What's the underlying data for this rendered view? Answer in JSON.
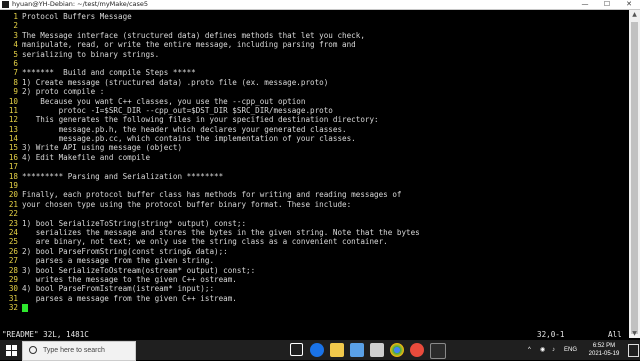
{
  "window": {
    "title": "hyuan@YH-Debian: ~/test/myMake/case5",
    "minimize": "—",
    "maximize": "☐",
    "close": "✕"
  },
  "editor": {
    "lines": [
      {
        "n": "1",
        "t": "Protocol Buffers Message"
      },
      {
        "n": "2",
        "t": ""
      },
      {
        "n": "3",
        "t": "The Message interface (structured data) defines methods that let you check,"
      },
      {
        "n": "4",
        "t": "manipulate, read, or write the entire message, including parsing from and"
      },
      {
        "n": "5",
        "t": "serializing to binary strings."
      },
      {
        "n": "6",
        "t": ""
      },
      {
        "n": "7",
        "t": "*******  Build and compile Steps *****"
      },
      {
        "n": "8",
        "t": "1) Create message (structured data) .proto file (ex. message.proto)"
      },
      {
        "n": "9",
        "t": "2) proto compile :"
      },
      {
        "n": "10",
        "t": "    Because you want C++ classes, you use the --cpp_out option"
      },
      {
        "n": "11",
        "t": "        protoc -I=$SRC_DIR --cpp_out=$DST_DIR $SRC_DIR/message.proto"
      },
      {
        "n": "12",
        "t": "   This generates the following files in your specified destination directory:"
      },
      {
        "n": "13",
        "t": "        message.pb.h, the header which declares your generated classes."
      },
      {
        "n": "14",
        "t": "        message.pb.cc, which contains the implementation of your classes."
      },
      {
        "n": "15",
        "t": "3) Write API using message (object)"
      },
      {
        "n": "16",
        "t": "4) Edit Makefile and compile"
      },
      {
        "n": "17",
        "t": ""
      },
      {
        "n": "18",
        "t": "********* Parsing and Serialization ********"
      },
      {
        "n": "19",
        "t": ""
      },
      {
        "n": "20",
        "t": "Finally, each protocol buffer class has methods for writing and reading messages of"
      },
      {
        "n": "21",
        "t": "your chosen type using the protocol buffer binary format. These include:"
      },
      {
        "n": "22",
        "t": ""
      },
      {
        "n": "23",
        "t": "1) bool SerializeToString(string* output) const;:"
      },
      {
        "n": "24",
        "t": "   serializes the message and stores the bytes in the given string. Note that the bytes"
      },
      {
        "n": "25",
        "t": "   are binary, not text; we only use the string class as a convenient container."
      },
      {
        "n": "26",
        "t": "2) bool ParseFromString(const string& data);:"
      },
      {
        "n": "27",
        "t": "   parses a message from the given string."
      },
      {
        "n": "28",
        "t": "3) bool SerializeToOstream(ostream* output) const;:"
      },
      {
        "n": "29",
        "t": "   writes the message to the given C++ ostream."
      },
      {
        "n": "30",
        "t": "4) bool ParseFromIstream(istream* input);:"
      },
      {
        "n": "31",
        "t": "   parses a message from the given C++ istream."
      },
      {
        "n": "32",
        "t": ""
      }
    ],
    "status_file": "\"README\" 32L, 1481C",
    "status_position": "32,0-1",
    "status_percent": "All"
  },
  "taskbar": {
    "search_placeholder": "Type here to search",
    "icons": [
      "task-view-icon",
      "edge-icon",
      "file-explorer-icon",
      "store-icon",
      "mail-icon",
      "chrome-icon",
      "app-icon",
      "terminal-icon"
    ],
    "tray_lang": "ENG",
    "clock_time": "6:52 PM",
    "clock_date": "2021-05-19"
  },
  "colors": {
    "line_number": "#e8d447",
    "text": "#d8d8d8",
    "cursor": "#2ee82e",
    "background": "#000000"
  }
}
